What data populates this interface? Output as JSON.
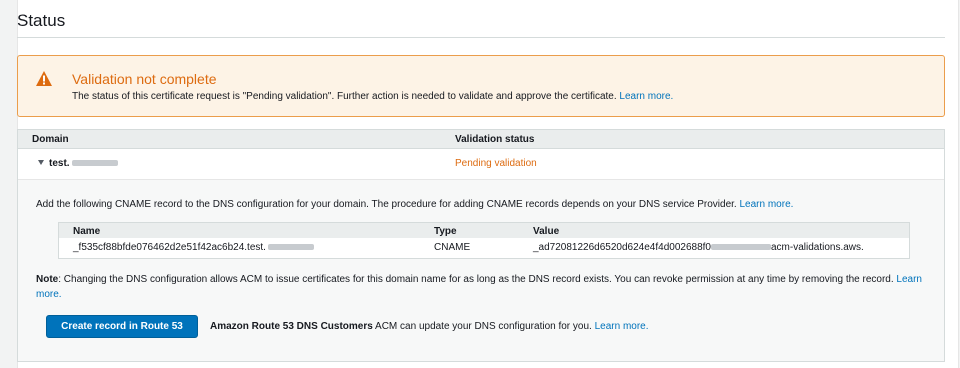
{
  "section": {
    "title": "Status"
  },
  "alert": {
    "title": "Validation not complete",
    "message": "The status of this certificate request is \"Pending validation\". Further action is needed to validate and approve the certificate. ",
    "link": "Learn more."
  },
  "table": {
    "headers": {
      "domain": "Domain",
      "status": "Validation status"
    },
    "row": {
      "domain": "test.",
      "status": "Pending validation"
    }
  },
  "details": {
    "instruction": "Add the following CNAME record to the DNS configuration for your domain. The procedure for adding CNAME records depends on your DNS service Provider. ",
    "instruction_link": "Learn more.",
    "record_headers": {
      "name": "Name",
      "type": "Type",
      "value": "Value"
    },
    "record": {
      "name": "_f535cf88bfde076462d2e51f42ac6b24.test.",
      "type": "CNAME",
      "value_start": "_ad72081226d6520d624e4f4d002688f0",
      "value_end": "acm-validations.aws."
    },
    "note_label": "Note",
    "note_text": ": Changing the DNS configuration allows ACM to issue certificates for this domain name for as long as the DNS record exists. You can revoke permission at any time by removing the record. ",
    "note_link": "Learn more.",
    "button_label": "Create record in Route 53",
    "cta_bold": "Amazon Route 53 DNS Customers",
    "cta_text": " ACM can update your DNS configuration for you. ",
    "cta_link": "Learn more."
  },
  "colors": {
    "warning": "#dd6b10",
    "primary": "#0073bb",
    "link": "#0073bb"
  },
  "icons": {
    "alert": "warning-triangle-icon",
    "expand": "caret-down-icon"
  }
}
